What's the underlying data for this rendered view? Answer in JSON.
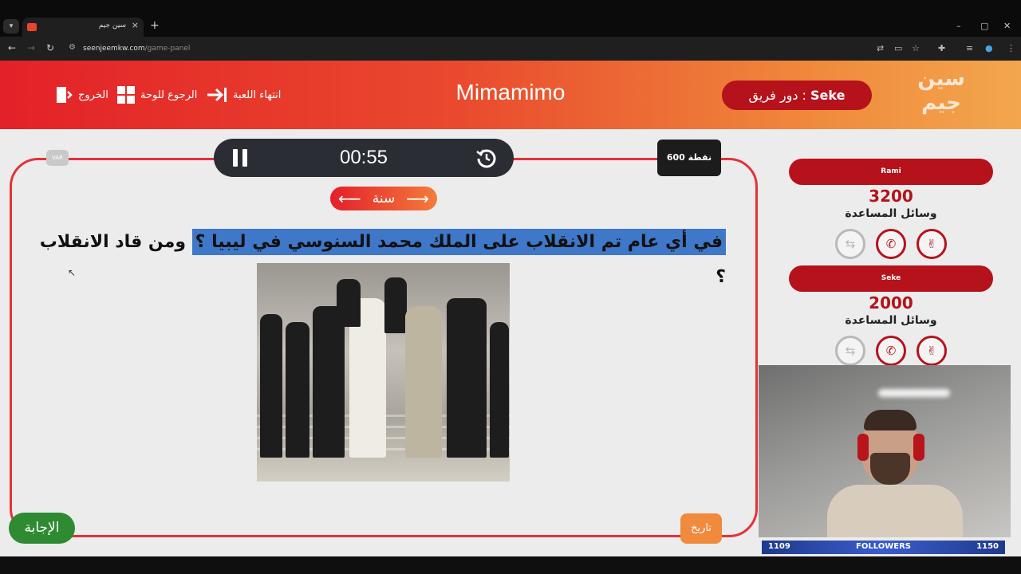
{
  "browser": {
    "tab_title": "سين جيم",
    "url_host": "seenjeemkw.com",
    "url_path": "/game-panel",
    "tab_menu_icon": "chevron-down-icon",
    "new_tab_icon": "plus-icon",
    "minimize": "–",
    "maximize": "▢",
    "close": "✕"
  },
  "header": {
    "exit_label": "الخروج",
    "board_label": "الرجوع للوحة",
    "end_game_label": "انتهاء اللعبة",
    "game_title": "Mimamimo",
    "turn_prefix": "دور فريق : ",
    "turn_team": "Seke",
    "logo_line1": "سين",
    "logo_line2": "جيم"
  },
  "question_panel": {
    "var_label": "VAR",
    "timer": "00:55",
    "points": "600 نقطة",
    "category": "سنة",
    "question_highlighted": "في أي عام تم الانقلاب على الملك محمد السنوسي في ليبيا ؟",
    "question_rest": " ومن قاد الانقلاب ؟",
    "answer_button": "الإجابة",
    "category_tag": "تاريخ"
  },
  "teams": [
    {
      "name": "Rami",
      "score": "3200",
      "help_label": "وسائل المساعدة"
    },
    {
      "name": "Seke",
      "score": "2000",
      "help_label": "وسائل المساعدة"
    }
  ],
  "help_icons": [
    "swap-icon",
    "phone-icon",
    "two-fingers-icon"
  ],
  "stream": {
    "followers_left": "1109",
    "followers_label": "FOLLOWERS",
    "followers_right": "1150"
  },
  "colors": {
    "header_start": "#e32128",
    "header_end": "#f3a64e",
    "team_red": "#b5121b",
    "answer_green": "#2e8b32",
    "highlight_blue": "#3f77c9"
  }
}
